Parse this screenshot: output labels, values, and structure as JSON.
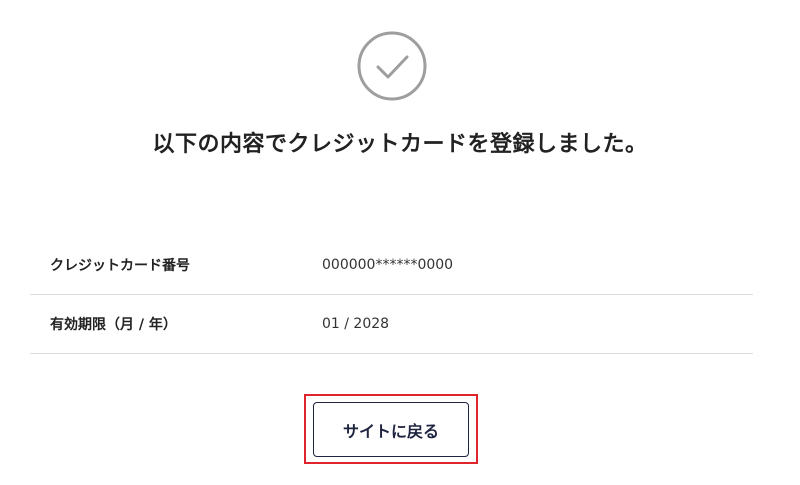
{
  "page": {
    "title": "以下の内容でクレジットカードを登録しました。"
  },
  "icons": {
    "success": "check-circle-icon"
  },
  "colors": {
    "icon_gray": "#9e9e9e",
    "divider": "#dddddd",
    "button_border": "#1e2340",
    "highlight_border": "#e0242b"
  },
  "card_info": {
    "rows": [
      {
        "label": "クレジットカード番号",
        "value": "000000******0000"
      },
      {
        "label": "有効期限（月 / 年）",
        "value": "01 / 2028"
      }
    ]
  },
  "actions": {
    "back_label": "サイトに戻る"
  }
}
